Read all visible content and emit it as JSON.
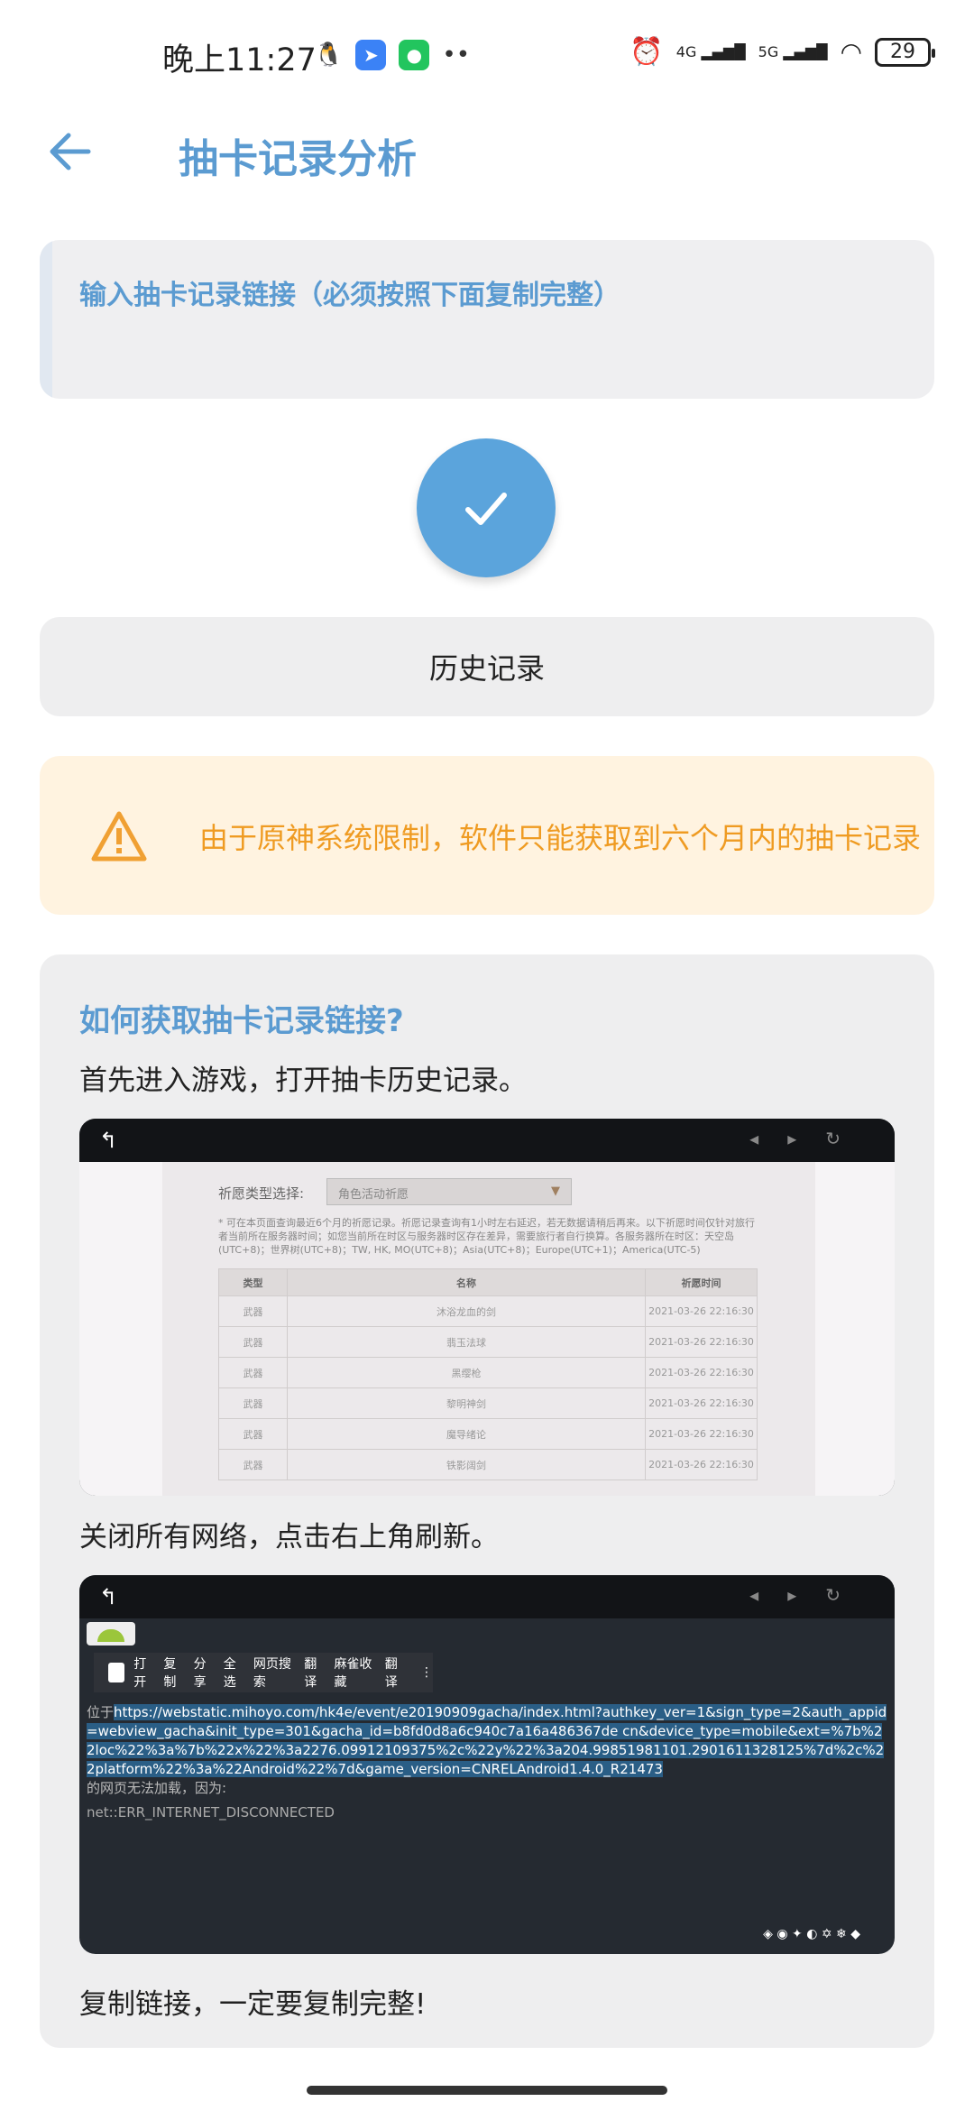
{
  "status": {
    "time": "晚上11:27",
    "battery": "29",
    "net1": "4G",
    "net2": "5G"
  },
  "header": {
    "title": "抽卡记录分析"
  },
  "input": {
    "placeholder": "输入抽卡记录链接（必须按照下面复制完整）"
  },
  "history_label": "历史记录",
  "warning": "由于原神系统限制，软件只能获取到六个月内的抽卡记录",
  "howto": {
    "title": "如何获取抽卡记录链接?",
    "step1": "首先进入游戏，打开抽卡历史记录。",
    "step2": "关闭所有网络，点击右上角刷新。",
    "step3": "复制链接，一定要复制完整!"
  },
  "shot1": {
    "type_label": "祈愿类型选择:",
    "type_value": "角色活动祈愿",
    "note": "* 可在本页面查询最近6个月的祈愿记录。祈愿记录查询有1小时左右延迟，若无数据请稍后再来。以下祈愿时间仅针对旅行者当前所在服务器时间；如您当前所在时区与服务器时区存在差异，需要旅行者自行换算。各服务器所在时区：天空岛(UTC+8)；世界树(UTC+8)；TW, HK, MO(UTC+8)；Asia(UTC+8)；Europe(UTC+1)；America(UTC-5)",
    "headers": [
      "类型",
      "名称",
      "祈愿时间"
    ],
    "rows": [
      [
        "武器",
        "沐浴龙血的剑",
        "2021-03-26 22:16:30"
      ],
      [
        "武器",
        "翡玉法球",
        "2021-03-26 22:16:30"
      ],
      [
        "武器",
        "黑缨枪",
        "2021-03-26 22:16:30"
      ],
      [
        "武器",
        "黎明神剑",
        "2021-03-26 22:16:30"
      ],
      [
        "武器",
        "魔导绪论",
        "2021-03-26 22:16:30"
      ],
      [
        "武器",
        "铁影阔剑",
        "2021-03-26 22:16:30"
      ]
    ]
  },
  "shot2": {
    "menu": [
      "打开",
      "复制",
      "分享",
      "全选",
      "网页搜索",
      "翻译",
      "麻雀收藏",
      "翻译"
    ],
    "prefix": "位于",
    "url": "https://webstatic.mihoyo.com/hk4e/event/e20190909gacha/index.html?authkey_ver=1&sign_type=2&auth_appid=webview_gacha&init_type=301&gacha_id=b8fd0d8a6c940c7a16a486367de cn&device_type=mobile&ext=%7b%22loc%22%3a%7b%22x%22%3a2276.09912109375%2c%22y%22%3a204.99851981101.2901611328125%7d%2c%22platform%22%3a%22Android%22%7d&game_version=CNRELAndroid1.4.0_R21473",
    "suffix": "的网页无法加载，因为:",
    "error": "net::ERR_INTERNET_DISCONNECTED"
  }
}
